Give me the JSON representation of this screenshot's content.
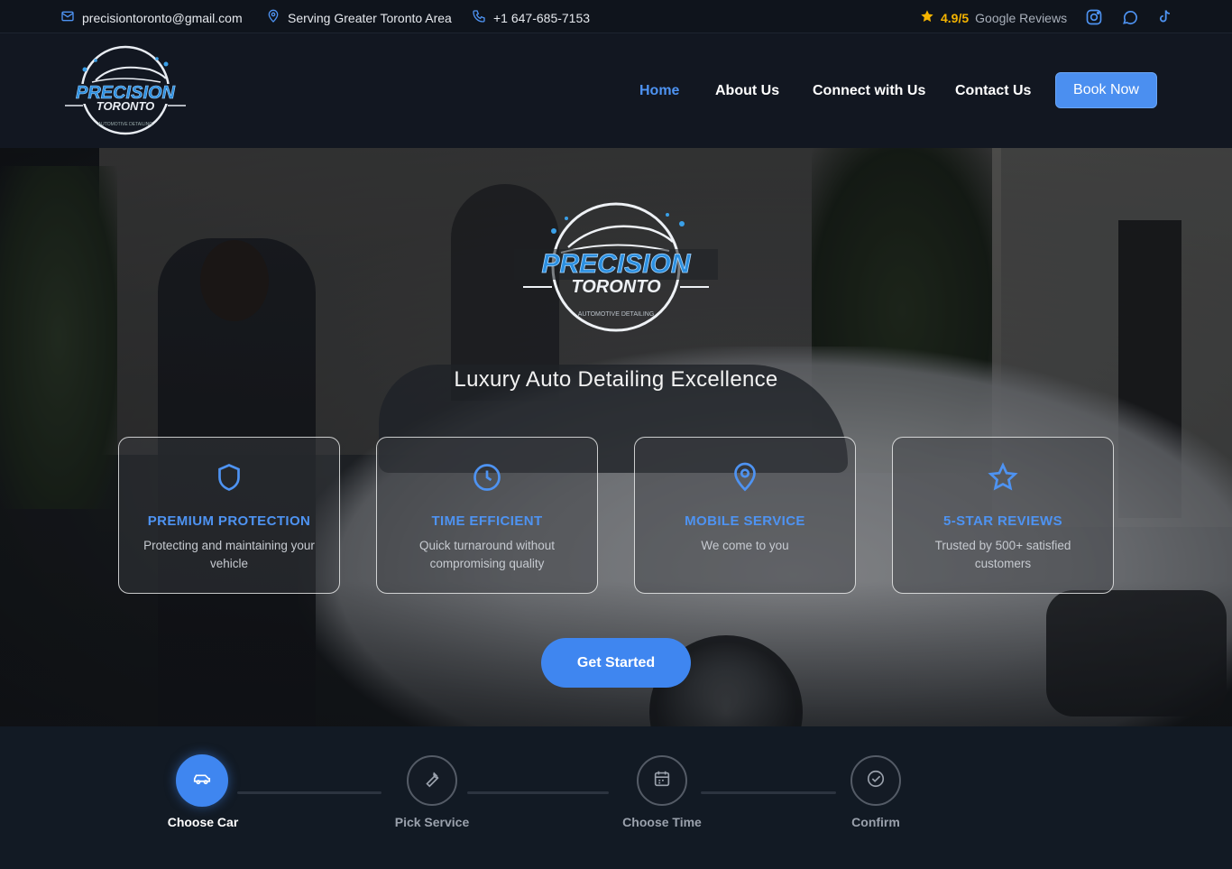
{
  "topbar": {
    "email": "precisiontoronto@gmail.com",
    "location": "Serving Greater Toronto Area",
    "phone": "+1 647-685-7153",
    "rating_score": "4.9/5",
    "rating_label": "Google Reviews",
    "social": [
      "instagram-icon",
      "whatsapp-icon",
      "tiktok-icon"
    ]
  },
  "brand": {
    "name_top": "PRECISION",
    "name_bottom": "TORONTO",
    "ring_text": "AUTOMOTIVE DETAILING"
  },
  "nav": {
    "items": [
      {
        "label": "Home",
        "active": true
      },
      {
        "label": "About Us",
        "active": false
      },
      {
        "label": "Connect with Us",
        "active": false
      },
      {
        "label": "Contact Us",
        "active": false
      }
    ],
    "cta": "Book Now"
  },
  "hero": {
    "tagline": "Luxury Auto Detailing Excellence",
    "cards": [
      {
        "icon": "shield-icon",
        "title": "PREMIUM PROTECTION",
        "desc": "Protecting and maintaining your vehicle"
      },
      {
        "icon": "clock-icon",
        "title": "TIME EFFICIENT",
        "desc": "Quick turnaround without compromising quality"
      },
      {
        "icon": "map-pin-icon",
        "title": "MOBILE SERVICE",
        "desc": "We come to you"
      },
      {
        "icon": "star-icon",
        "title": "5-STAR REVIEWS",
        "desc": "Trusted by 500+ satisfied customers"
      }
    ],
    "cta": "Get Started"
  },
  "steps": [
    {
      "icon": "car-icon",
      "label": "Choose Car",
      "active": true
    },
    {
      "icon": "wrench-icon",
      "label": "Pick Service",
      "active": false
    },
    {
      "icon": "calendar-icon",
      "label": "Choose Time",
      "active": false
    },
    {
      "icon": "check-circle-icon",
      "label": "Confirm",
      "active": false
    }
  ],
  "colors": {
    "accent": "#4e93f2",
    "button": "#3f86f0",
    "star": "#f5b400",
    "background": "#111620"
  }
}
